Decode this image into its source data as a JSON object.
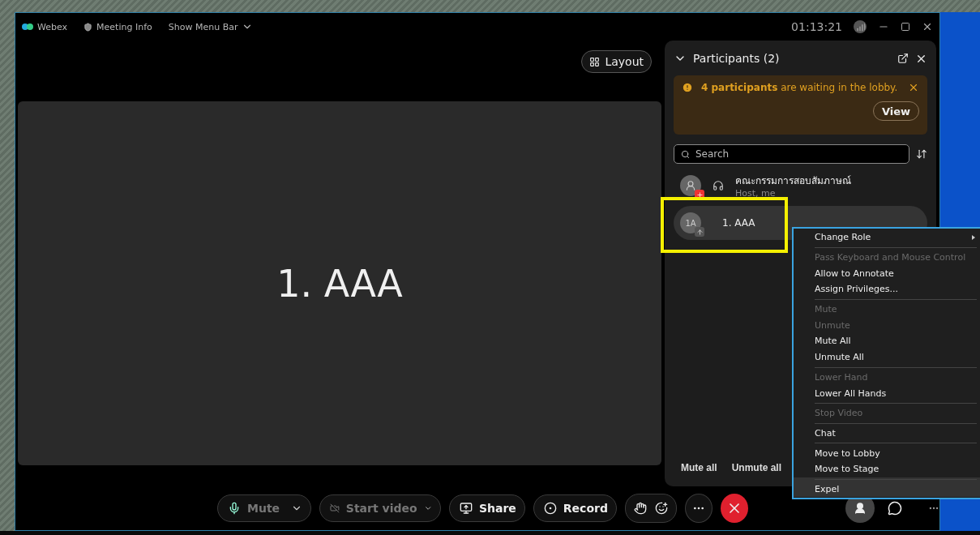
{
  "title_bar": {
    "app_name": "Webex",
    "meeting_info": "Meeting Info",
    "menu_toggle": "Show Menu Bar",
    "timer": "01:13:21"
  },
  "stage": {
    "layout_button": "Layout",
    "video_label": "1. AAA"
  },
  "participants_panel": {
    "title": "Participants (2)",
    "expanded": true,
    "lobby_banner": {
      "count_text": "4 participants",
      "text": " are waiting in the lobby.",
      "view_button": "View"
    },
    "search": {
      "placeholder": "Search"
    },
    "participants": [
      {
        "name": "คณะกรรมการสอบสัมภาษณ์",
        "role": "Host, me",
        "selected": false,
        "kind": "host"
      },
      {
        "name": "1. AAA",
        "initials": "1A",
        "selected": true,
        "kind": "guest"
      }
    ],
    "footer_buttons": [
      "Mute all",
      "Unmute all"
    ]
  },
  "highlight_box": {
    "on": true
  },
  "context_menu": {
    "items": [
      {
        "label": "Change Role",
        "disabled": false,
        "highlighted": false,
        "has_submenu": true,
        "separator_above": false
      },
      {
        "label": "Pass Keyboard and Mouse Control",
        "disabled": true,
        "highlighted": false,
        "has_submenu": false,
        "separator_above": true
      },
      {
        "label": "Allow to Annotate",
        "disabled": false,
        "highlighted": false,
        "has_submenu": false,
        "separator_above": false
      },
      {
        "label": "Assign Privileges...",
        "disabled": false,
        "highlighted": false,
        "has_submenu": false,
        "separator_above": false
      },
      {
        "label": "Mute",
        "disabled": true,
        "highlighted": false,
        "has_submenu": false,
        "separator_above": true
      },
      {
        "label": "Unmute",
        "disabled": true,
        "highlighted": false,
        "has_submenu": false,
        "separator_above": false
      },
      {
        "label": "Mute All",
        "disabled": false,
        "highlighted": false,
        "has_submenu": false,
        "separator_above": false
      },
      {
        "label": "Unmute All",
        "disabled": false,
        "highlighted": false,
        "has_submenu": false,
        "separator_above": false
      },
      {
        "label": "Lower Hand",
        "disabled": true,
        "highlighted": false,
        "has_submenu": false,
        "separator_above": true
      },
      {
        "label": "Lower All Hands",
        "disabled": false,
        "highlighted": false,
        "has_submenu": false,
        "separator_above": false
      },
      {
        "label": "Stop Video",
        "disabled": true,
        "highlighted": false,
        "has_submenu": false,
        "separator_above": true
      },
      {
        "label": "Chat",
        "disabled": false,
        "highlighted": false,
        "has_submenu": false,
        "separator_above": true
      },
      {
        "label": "Move to Lobby",
        "disabled": false,
        "highlighted": false,
        "has_submenu": false,
        "separator_above": true
      },
      {
        "label": "Move to Stage",
        "disabled": false,
        "highlighted": false,
        "has_submenu": false,
        "separator_above": false
      },
      {
        "label": "Expel",
        "disabled": false,
        "highlighted": true,
        "has_submenu": false,
        "separator_above": true
      }
    ]
  },
  "toolbar": {
    "buttons": [
      {
        "kind": "mute",
        "label": "Mute",
        "disabled": true
      },
      {
        "kind": "video",
        "label": "Start video",
        "disabled": true
      },
      {
        "kind": "share",
        "label": "Share",
        "disabled": false
      },
      {
        "kind": "record",
        "label": "Record",
        "disabled": false
      }
    ],
    "participants_active": true
  }
}
